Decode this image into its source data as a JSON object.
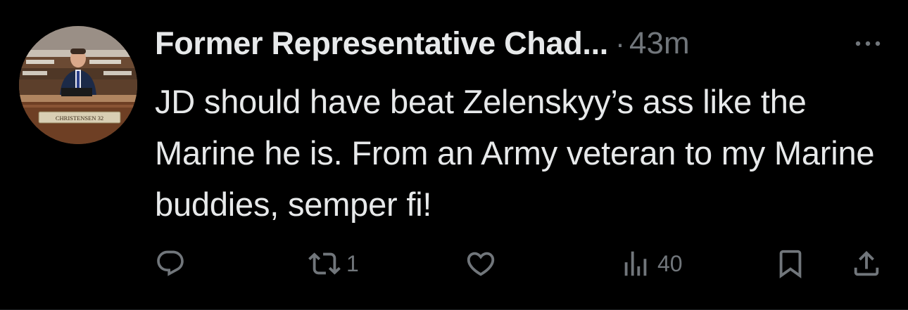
{
  "tweet": {
    "author_name": "Former Representative Chad...",
    "separator": "·",
    "timestamp": "43m",
    "text": "JD should have beat Zelenskyy’s ass like the Marine he is. From an Army veteran to my Marine buddies, semper fi!",
    "avatar": {
      "nameplate_text": "CHRISTENSEN   32"
    }
  },
  "actions": {
    "reply": {
      "icon": "reply-icon",
      "count": ""
    },
    "retweet": {
      "icon": "retweet-icon",
      "count": "1"
    },
    "like": {
      "icon": "heart-icon",
      "count": ""
    },
    "views": {
      "icon": "views-icon",
      "count": "40"
    },
    "bookmark": {
      "icon": "bookmark-icon"
    },
    "share": {
      "icon": "share-icon"
    }
  },
  "colors": {
    "background": "#000000",
    "text_primary": "#e7e9ea",
    "text_secondary": "#71767b"
  }
}
